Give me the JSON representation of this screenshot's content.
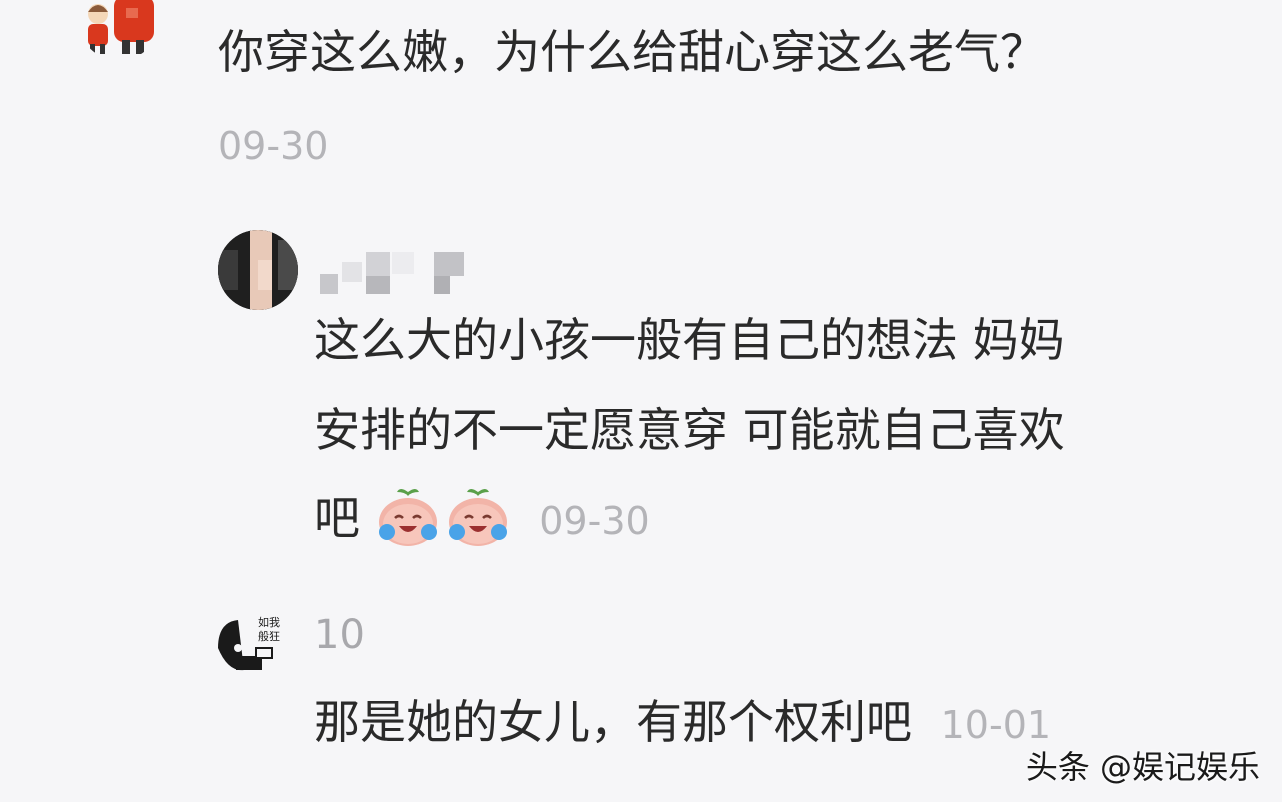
{
  "comments": [
    {
      "text": "你穿这么嫩，为什么给甜心穿这么老气？",
      "time": "09-30",
      "avatar_icon": "cartoon-child-avatar-icon"
    },
    {
      "username": "",
      "lines": [
        "这么大的小孩一般有自己的想法 妈妈",
        "安排的不一定愿意穿 可能就自己喜欢",
        "吧"
      ],
      "time": "09-30",
      "emojis": [
        "crying-laughing-peach-emoji",
        "crying-laughing-peach-emoji"
      ],
      "avatar_icon": "pixelated-avatar-icon"
    },
    {
      "username": "10",
      "text": "那是她的女儿，有那个权利吧",
      "time": "10-01",
      "avatar_icon": "meme-avatar-icon",
      "avatar_caption": [
        "如我",
        "般狂"
      ]
    }
  ],
  "watermark": "头条 @娱记娱乐",
  "colors": {
    "background": "#f6f6f8",
    "text": "#2a2a2a",
    "meta": "#b4b4b8"
  }
}
